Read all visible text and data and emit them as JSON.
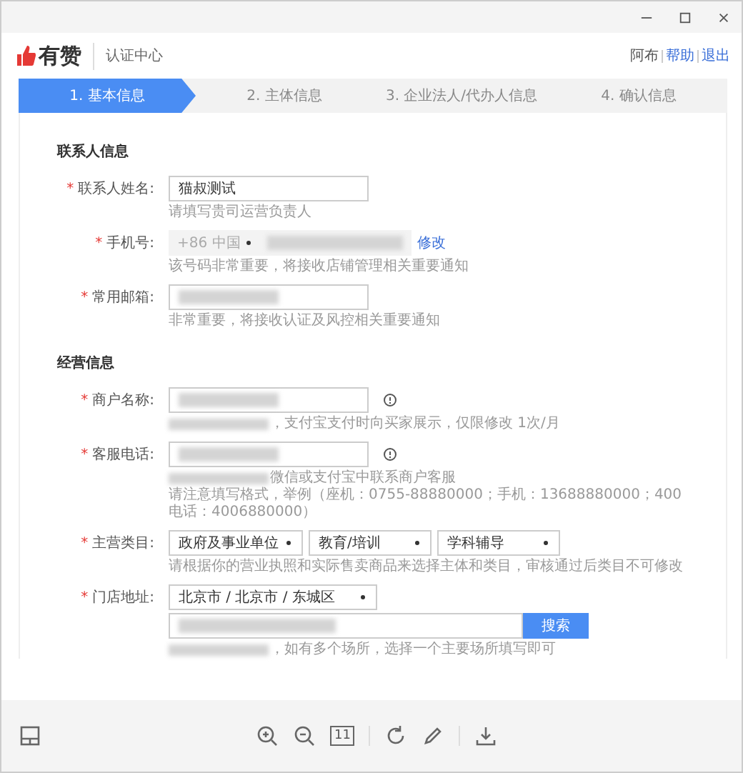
{
  "header": {
    "logo": "有赞",
    "subtitle": "认证中心",
    "links": [
      {
        "label": "阿布",
        "kind": "user"
      },
      {
        "label": "帮助",
        "kind": "link"
      },
      {
        "label": "退出",
        "kind": "link"
      }
    ]
  },
  "steps": [
    {
      "label": "1. 基本信息",
      "selected": true
    },
    {
      "label": "2. 主体信息",
      "selected": false
    },
    {
      "label": "3. 企业法人/代办人信息",
      "selected": false
    },
    {
      "label": "4. 确认信息",
      "selected": false
    }
  ],
  "sections": [
    {
      "title": "联系人信息",
      "fields": [
        {
          "kind": "text",
          "label": "联系人姓名:",
          "mark": "*",
          "value": "猫叔测试",
          "hints": [
            {
              "text": "请填写贵司运营负责人"
            }
          ]
        },
        {
          "kind": "phone",
          "label": "手机号:",
          "mark": "*",
          "country": "+86 中国",
          "redacted": true,
          "link": "修改",
          "hints": [
            {
              "text": "该号码非常重要，将接收店铺管理相关重要通知"
            }
          ]
        },
        {
          "kind": "text",
          "label": "常用邮箱:",
          "mark": "*",
          "redacted": true,
          "hints": [
            {
              "text": "非常重要，将接收认证及风控相关重要通知"
            }
          ]
        }
      ]
    },
    {
      "title": "经营信息",
      "fields": [
        {
          "kind": "text",
          "label": "商户名称:",
          "mark": "*",
          "redacted": true,
          "help": true,
          "hints": [
            {
              "text": "，支付宝支付时向买家展示，仅限修改 1次/月",
              "redacted": true
            }
          ]
        },
        {
          "kind": "text",
          "label": "客服电话:",
          "mark": "*",
          "redacted": true,
          "help": true,
          "hints": [
            {
              "text": "微信或支付宝中联系商户客服",
              "redacted": true
            },
            {
              "text": "请注意填写格式，举例（座机：0755-88880000；手机：13688880000；400电话：4006880000）"
            }
          ]
        },
        {
          "kind": "selects",
          "label": "主营类目:",
          "mark": "*",
          "options": [
            "政府及事业单位",
            "教育/培训",
            "学科辅导"
          ],
          "hints": [
            {
              "text": "请根据你的营业执照和实际售卖商品来选择主体和类目，审核通过后类目不可修改"
            }
          ]
        },
        {
          "kind": "address",
          "label": "门店地址:",
          "mark": "*",
          "region": "北京市 / 北京市 / 东城区",
          "redacted": true,
          "button": "搜索",
          "hints": [
            {
              "text": "，如有多个场所，选择一个主要场所填写即可",
              "redacted": true
            }
          ]
        }
      ]
    }
  ],
  "toolbar": {
    "actual_size": "11"
  }
}
